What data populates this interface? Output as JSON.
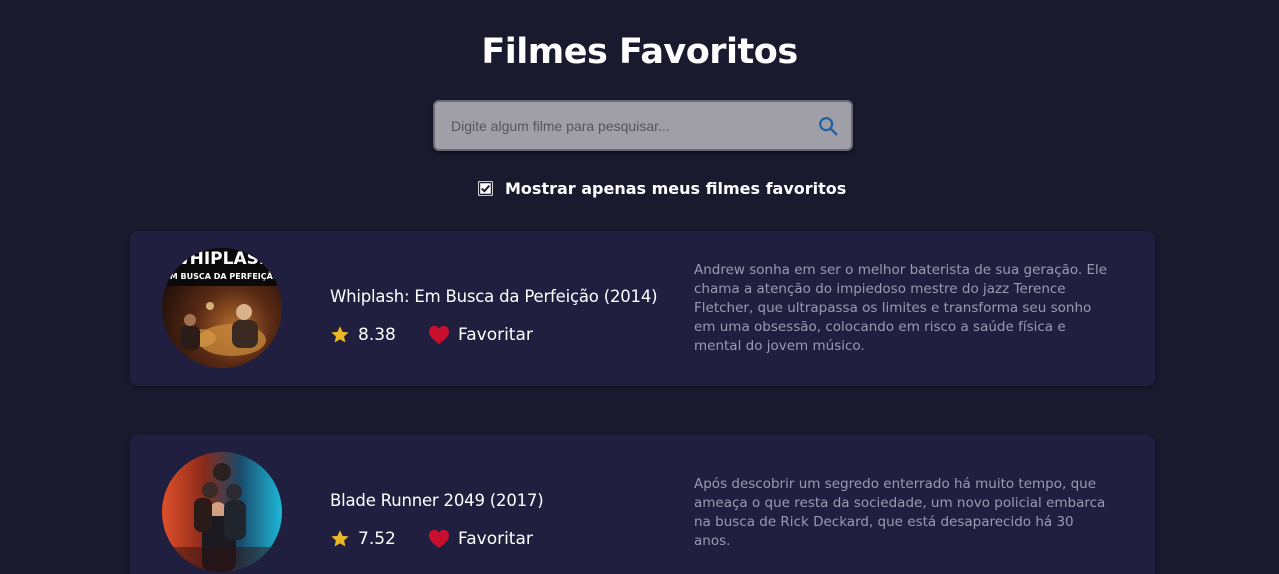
{
  "header": {
    "title": "Filmes Favoritos"
  },
  "search": {
    "placeholder": "Digite algum filme para pesquisar...",
    "value": ""
  },
  "filter": {
    "label": "Mostrar apenas meus filmes favoritos",
    "checked": true
  },
  "movies": [
    {
      "title": "Whiplash: Em Busca da Perfeição (2014)",
      "rating": "8.38",
      "favorite_label": "Favoritar",
      "overview": "Andrew sonha em ser o melhor baterista de sua geração. Ele chama a atenção do impiedoso mestre do jazz Terence Fletcher, que ultrapassa os limites e transforma seu sonho em uma obsessão, colocando em risco a saúde física e mental do jovem músico.",
      "poster_text_top": "WHIPLASH",
      "poster_text_sub": "EM BUSCA DA PERFEIÇÃO"
    },
    {
      "title": "Blade Runner 2049 (2017)",
      "rating": "7.52",
      "favorite_label": "Favoritar",
      "overview": "Após descobrir um segredo enterrado há muito tempo, que ameaça o que resta da sociedade, um novo policial embarca na busca de Rick Deckard, que está desaparecido há 30 anos."
    }
  ],
  "colors": {
    "background": "#1a1a2e",
    "card": "#201f3f",
    "search_bg": "#a09fa8",
    "star": "#e9b824",
    "heart": "#c8102e",
    "overview_text": "#9b9ab2",
    "search_icon": "#1f5fa8"
  },
  "icons": {
    "search": "search-icon",
    "star": "star-icon",
    "heart": "heart-icon",
    "checkbox": "checkbox-checked-icon"
  }
}
